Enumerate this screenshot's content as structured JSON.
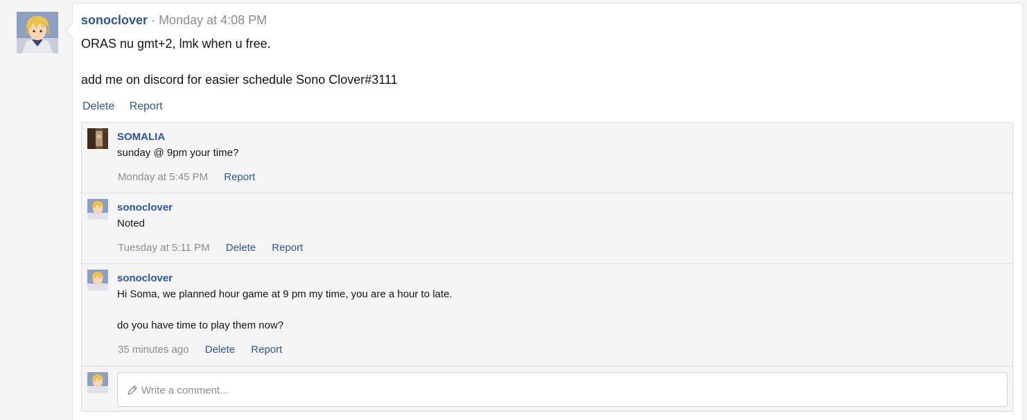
{
  "post": {
    "author": "sonoclover",
    "separator": "·",
    "timestamp": "Monday at 4:08 PM",
    "lines": [
      "ORAS nu gmt+2, lmk when u free.",
      "add me on discord for easier schedule Sono Clover#3111"
    ],
    "actions": {
      "delete": "Delete",
      "report": "Report"
    }
  },
  "comments": [
    {
      "author": "SOMALIA",
      "lines": [
        "sunday @ 9pm your time?"
      ],
      "timestamp": "Monday at 5:45 PM",
      "report": "Report"
    },
    {
      "author": "sonoclover",
      "lines": [
        "Noted"
      ],
      "timestamp": "Tuesday at 5:11 PM",
      "delete": "Delete",
      "report": "Report"
    },
    {
      "author": "sonoclover",
      "lines": [
        "Hi Soma, we planned hour game at 9 pm my time, you are a hour to late.",
        "do you have time to play them now?"
      ],
      "timestamp": "35 minutes ago",
      "delete": "Delete",
      "report": "Report"
    }
  ],
  "composer": {
    "placeholder": "Write a comment..."
  },
  "icons": {
    "composer": "pencil-icon"
  },
  "colors": {
    "link": "#2b54a3",
    "muted": "#8c8c8c",
    "panel": "#f5f5f5"
  }
}
